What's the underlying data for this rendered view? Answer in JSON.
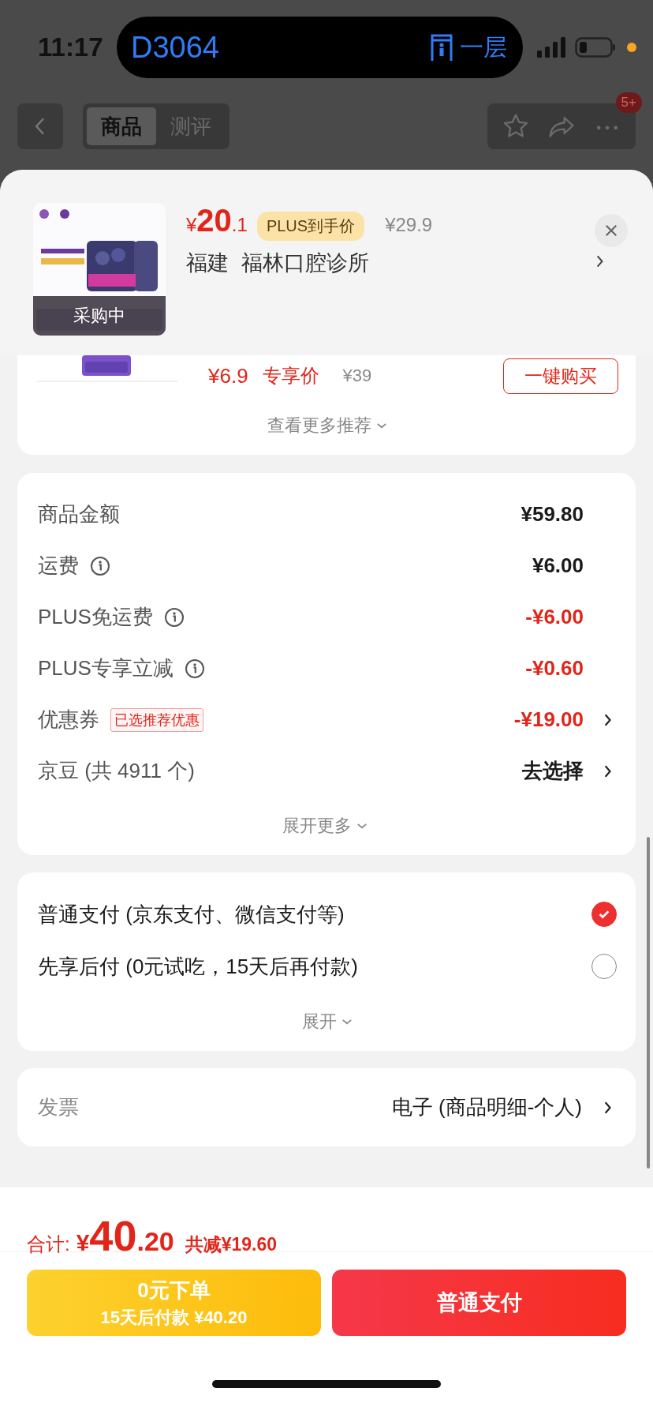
{
  "status_bar": {
    "time": "11:17",
    "island": {
      "code": "D3064",
      "floor": "一层"
    }
  },
  "nav": {
    "tabs": [
      {
        "label": "商品",
        "selected": true
      },
      {
        "label": "测评",
        "selected": false
      }
    ],
    "badge": "5+"
  },
  "popup": {
    "currency": "¥",
    "price_int": "20",
    "price_dec": ".1",
    "plus_tag": "PLUS到手价",
    "original_price": "¥29.9",
    "location": [
      "福建",
      "福林口腔诊所"
    ],
    "image_overlay": "采购中"
  },
  "recommendation": {
    "price": "¥6.9",
    "price_label": "专享价",
    "original_price": "¥39",
    "buy_button": "一键购买",
    "more": "查看更多推荐"
  },
  "summary": {
    "rows": [
      {
        "label": "商品金额",
        "info": false,
        "value": "¥59.80",
        "discount": false,
        "arrow": false
      },
      {
        "label": "运费",
        "info": true,
        "value": "¥6.00",
        "discount": false,
        "arrow": false
      },
      {
        "label": "PLUS免运费",
        "info": true,
        "value": "-¥6.00",
        "discount": true,
        "arrow": false
      },
      {
        "label": "PLUS专享立减",
        "info": true,
        "value": "-¥0.60",
        "discount": true,
        "arrow": false
      },
      {
        "label": "优惠券",
        "info": false,
        "tag": "已选推荐优惠",
        "value": "-¥19.00",
        "discount": true,
        "arrow": true
      },
      {
        "label": "京豆 (共 4911 个)",
        "info": false,
        "value": "去选择",
        "discount": false,
        "arrow": true
      }
    ],
    "expand": "展开更多"
  },
  "payment": {
    "options": [
      {
        "label": "普通支付 (京东支付、微信支付等)",
        "selected": true
      },
      {
        "label": "先享后付 (0元试吃，15天后再付款)",
        "selected": false
      }
    ],
    "expand": "展开"
  },
  "invoice": {
    "label": "发票",
    "value": "电子 (商品明细-个人)"
  },
  "footer": {
    "total_label": "合计:",
    "currency": "¥",
    "total_int": "40",
    "total_dec": ".20",
    "saving": "共减¥19.60",
    "buttons": [
      {
        "kind": "later",
        "title": "0元下单",
        "subtitle": "15天后付款 ¥40.20"
      },
      {
        "kind": "normal",
        "title": "普通支付"
      }
    ]
  }
}
